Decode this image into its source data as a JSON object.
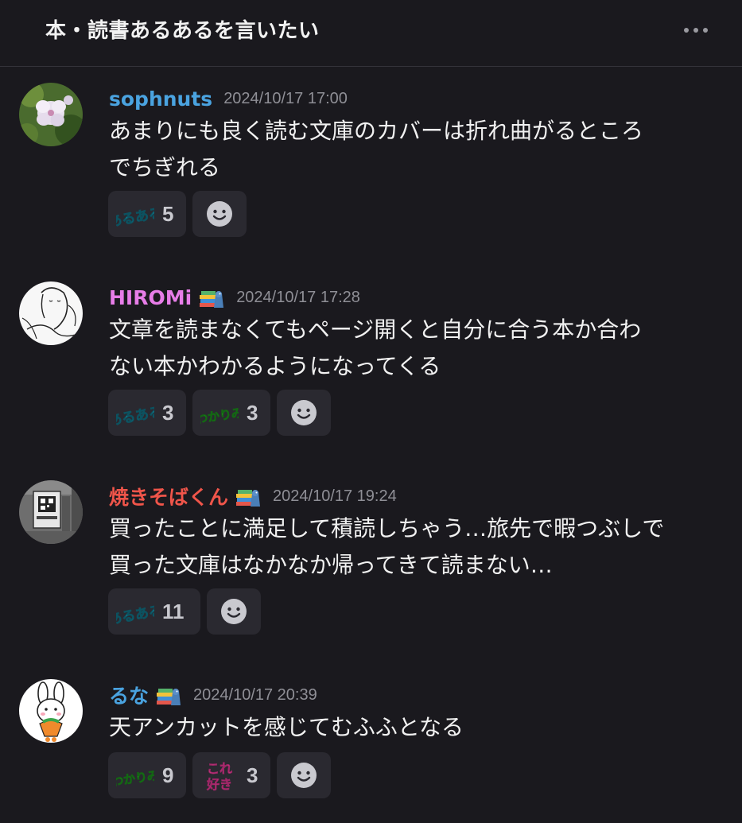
{
  "header": {
    "title": "本・読書あるあるを言いたい",
    "more_icon": "more-horizontal-icon"
  },
  "colors": {
    "background": "#1a191e",
    "chip": "#2a2930",
    "aruaru": "#1fa0b4",
    "wakarimi": "#2fc22f",
    "koresuki": "#ff5fa8"
  },
  "stamps": {
    "aruaru": "あるある",
    "wakarimi": "わかりみ",
    "koresuki_top": "これ",
    "koresuki_bottom": "好き"
  },
  "posts": [
    {
      "username": "sophnuts",
      "username_color": "#4aa3e0",
      "timestamp": "2024/10/17 17:00",
      "lines": [
        "あまりにも良く読む文庫のカバーは折れ曲がるところ",
        "でちぎれる"
      ],
      "badge": false,
      "reactions": [
        {
          "stamp": "aruaru",
          "count": "5"
        }
      ]
    },
    {
      "username": "HIROMi",
      "username_color": "#e77de8",
      "timestamp": "2024/10/17 17:28",
      "lines": [
        "文章を読まなくてもページ開くと自分に合う本か合わ",
        "ない本かわかるようになってくる"
      ],
      "badge": true,
      "reactions": [
        {
          "stamp": "aruaru",
          "count": "3"
        },
        {
          "stamp": "wakarimi",
          "count": "3"
        }
      ]
    },
    {
      "username": "焼きそばくん",
      "username_color": "#f0554a",
      "timestamp": "2024/10/17 19:24",
      "lines": [
        "買ったことに満足して積読しちゃう…旅先で暇つぶしで",
        "買った文庫はなかなか帰ってきて読まない…"
      ],
      "badge": true,
      "reactions": [
        {
          "stamp": "aruaru",
          "count": "11"
        }
      ]
    },
    {
      "username": "るな",
      "username_color": "#4aa3e0",
      "timestamp": "2024/10/17 20:39",
      "lines": [
        "天アンカットを感じてむふふとなる"
      ],
      "badge": true,
      "reactions": [
        {
          "stamp": "wakarimi",
          "count": "9"
        },
        {
          "stamp": "koresuki",
          "count": "3"
        }
      ]
    }
  ]
}
